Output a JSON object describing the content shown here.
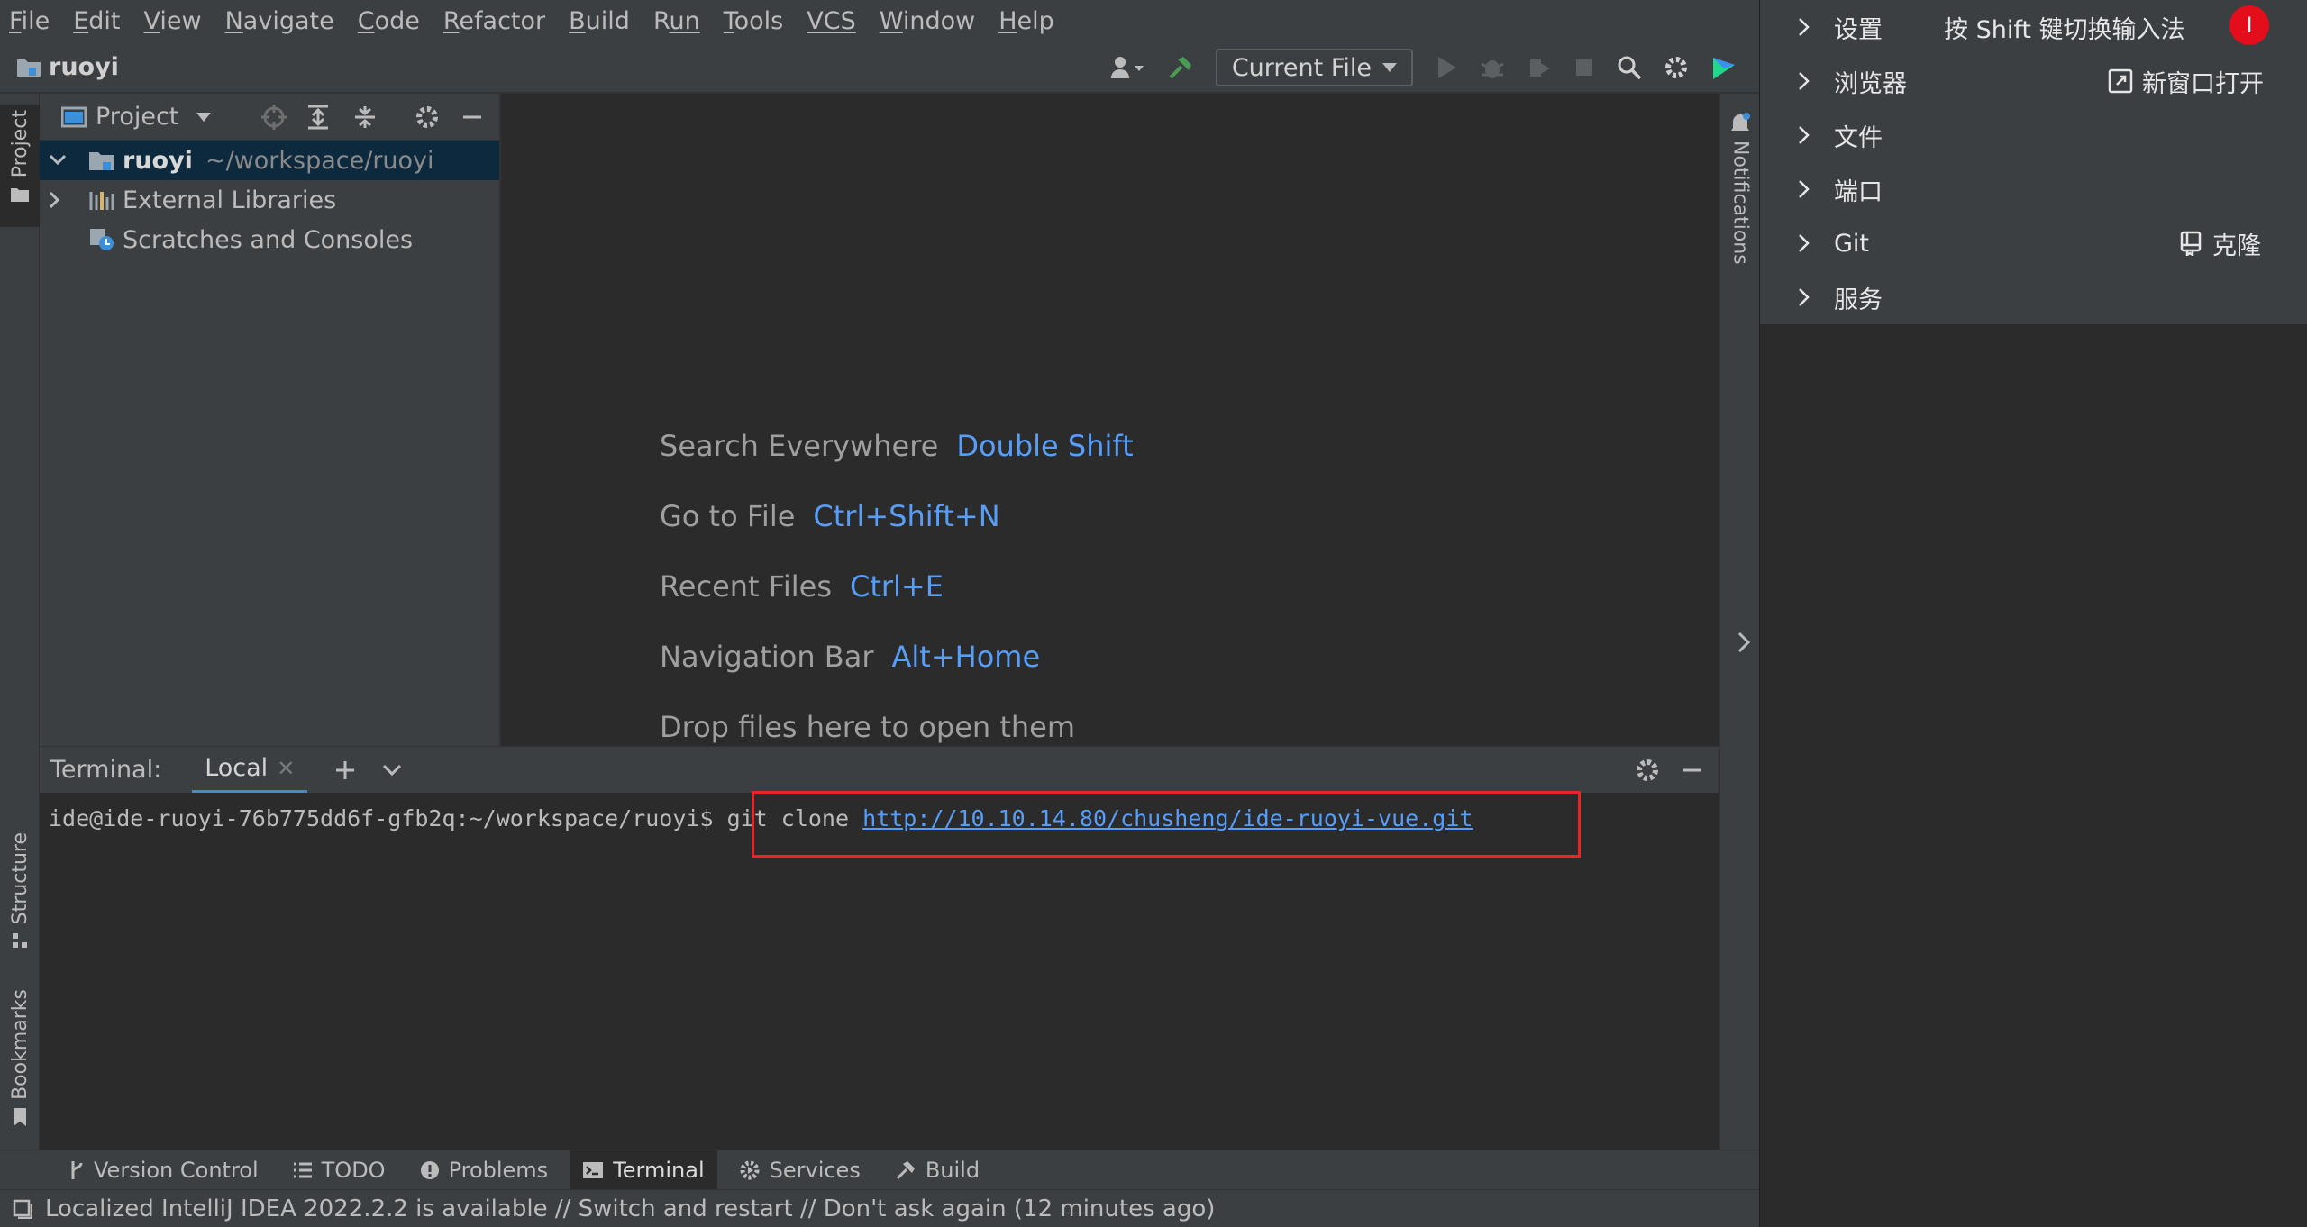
{
  "menubar": {
    "items": [
      {
        "first": "F",
        "rest": "ile"
      },
      {
        "first": "E",
        "rest": "dit"
      },
      {
        "first": "V",
        "rest": "iew"
      },
      {
        "first": "N",
        "rest": "avigate"
      },
      {
        "first": "C",
        "rest": "ode"
      },
      {
        "first": "R",
        "rest": "efactor"
      },
      {
        "first": "B",
        "rest": "uild"
      },
      {
        "first": "R",
        "rest": "un",
        "u_last": true
      },
      {
        "first": "T",
        "rest": "ools"
      },
      {
        "first": "VCS",
        "rest": ""
      },
      {
        "first": "W",
        "rest": "indow"
      },
      {
        "first": "H",
        "rest": "elp"
      }
    ]
  },
  "navbar": {
    "project_name": "ruoyi",
    "run_config": "Current File"
  },
  "left_stripe": {
    "project_tab": "Project",
    "structure_tab": "Structure",
    "bookmarks_tab": "Bookmarks"
  },
  "project_panel": {
    "title": "Project",
    "tree": {
      "root_name": "ruoyi",
      "root_path": "~/workspace/ruoyi",
      "external_libraries": "External Libraries",
      "scratches": "Scratches and Consoles"
    }
  },
  "editor": {
    "hints": [
      {
        "label": "Search Everywhere",
        "key": "Double Shift"
      },
      {
        "label": "Go to File",
        "key": "Ctrl+Shift+N"
      },
      {
        "label": "Recent Files",
        "key": "Ctrl+E"
      },
      {
        "label": "Navigation Bar",
        "key": "Alt+Home"
      },
      {
        "label": "Drop files here to open them",
        "key": ""
      }
    ]
  },
  "right_stripe": {
    "notifications_tab": "Notifications"
  },
  "terminal": {
    "label": "Terminal:",
    "tab_name": "Local",
    "prompt": "ide@ide-ruoyi-76b775dd6f-gfb2q:~/workspace/ruoyi$",
    "command": "git clone",
    "url": "http://10.10.14.80/chusheng/ide-ruoyi-vue.git"
  },
  "bottom_bar": {
    "tabs": [
      {
        "label": "Version Control",
        "icon": "branch-icon"
      },
      {
        "label": "TODO",
        "icon": "list-icon"
      },
      {
        "label": "Problems",
        "icon": "exclamation-icon"
      },
      {
        "label": "Terminal",
        "icon": "terminal-icon",
        "active": true
      },
      {
        "label": "Services",
        "icon": "services-icon"
      },
      {
        "label": "Build",
        "icon": "hammer-icon"
      }
    ]
  },
  "status_bar": {
    "message": "Localized IntelliJ IDEA 2022.2.2 is available // Switch and restart // Don't ask again (12 minutes ago)"
  },
  "overlay_menu": {
    "ime_hint": "按 Shift 键切换输入法",
    "ime_badge": "I",
    "items": [
      {
        "label": "设置",
        "extra": ""
      },
      {
        "label": "浏览器",
        "extra": "新窗口打开"
      },
      {
        "label": "文件",
        "extra": ""
      },
      {
        "label": "端口",
        "extra": ""
      },
      {
        "label": "Git",
        "extra": "克隆"
      },
      {
        "label": "服务",
        "extra": ""
      }
    ]
  },
  "colors": {
    "accent_link": "#589df6",
    "highlight_box": "#e5262a",
    "selection": "#0d293e"
  }
}
